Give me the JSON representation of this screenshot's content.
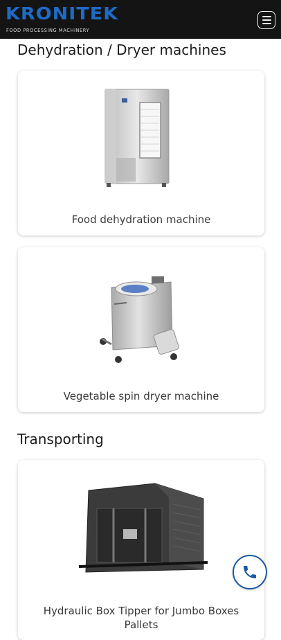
{
  "header": {
    "logo_text": "KRONITEK",
    "logo_tagline": "FOOD PROCESSING MACHINERY",
    "menu_icon": "hamburger-menu-icon"
  },
  "sections": [
    {
      "title": "Dehydration / Dryer machines",
      "products": [
        {
          "name": "Food dehydration machine"
        },
        {
          "name": "Vegetable spin dryer machine"
        }
      ]
    },
    {
      "title": "Transporting",
      "products": [
        {
          "name": "Hydraulic Box Tipper for Jumbo Boxes Pallets"
        }
      ]
    }
  ],
  "floating": {
    "call_icon": "phone-icon"
  },
  "colors": {
    "header_bg": "#141414",
    "brand_blue": "#1f6bc4",
    "call_ring": "#1c5aa5"
  }
}
